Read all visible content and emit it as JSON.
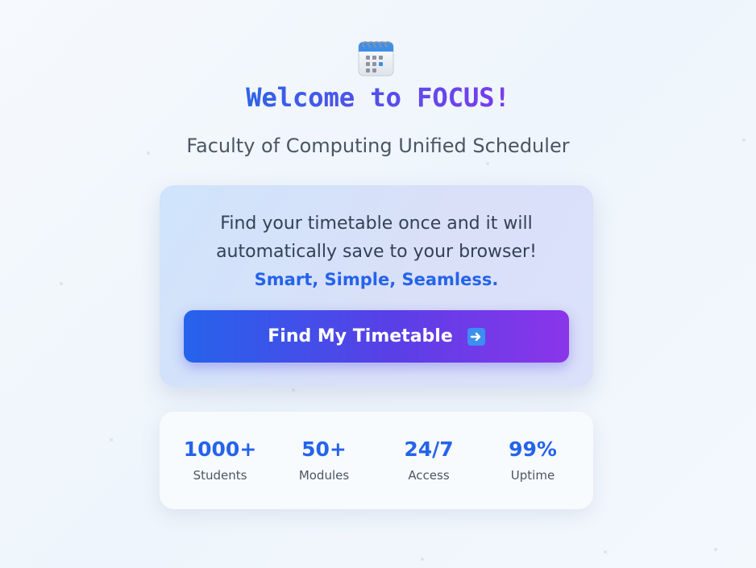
{
  "header": {
    "title": "Welcome to FOCUS!",
    "subtitle": "Faculty of Computing Unified Scheduler"
  },
  "logo": {
    "icon": "calendar-icon"
  },
  "card": {
    "line1": "Find your timetable once and it will",
    "line2": "automatically save to your browser!",
    "tagline": "Smart, Simple, Seamless.",
    "button_label": "Find My Timetable",
    "button_icon": "arrow-right-icon"
  },
  "stats": [
    {
      "value": "1000+",
      "label": "Students"
    },
    {
      "value": "50+",
      "label": "Modules"
    },
    {
      "value": "24/7",
      "label": "Access"
    },
    {
      "value": "99%",
      "label": "Uptime"
    }
  ],
  "colors": {
    "accent_blue": "#2563eb",
    "accent_purple": "#7c3aed",
    "text_dark": "#334155"
  }
}
